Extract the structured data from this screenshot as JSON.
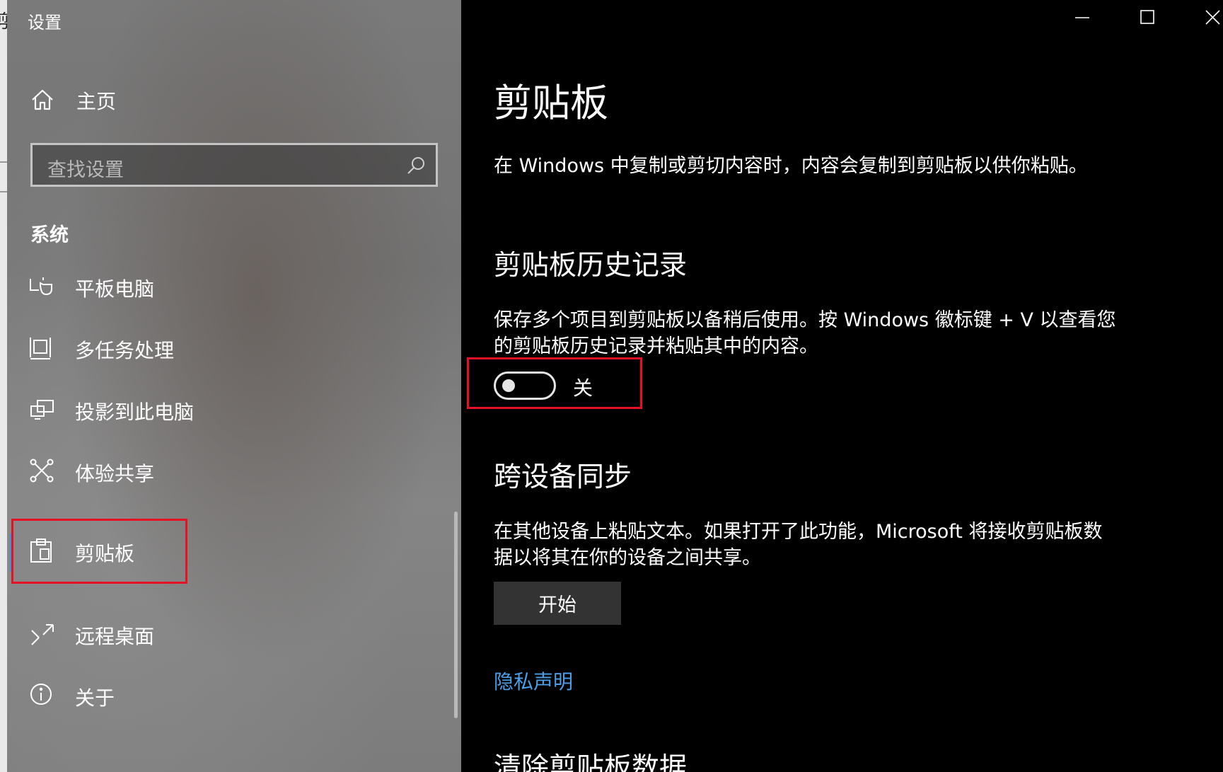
{
  "window": {
    "app_title": "设置",
    "controls": {
      "minimize_icon": "minimize-icon",
      "maximize_icon": "maximize-icon",
      "close_icon": "close-icon"
    }
  },
  "peek": {
    "char": "剪"
  },
  "sidebar": {
    "home": {
      "label": "主页",
      "icon": "home-icon"
    },
    "search": {
      "placeholder": "查找设置",
      "icon": "search-icon"
    },
    "section_label": "系统",
    "items": [
      {
        "label": "平板电脑",
        "icon": "tablet-icon",
        "selected": false
      },
      {
        "label": "多任务处理",
        "icon": "multitasking-icon",
        "selected": false
      },
      {
        "label": "投影到此电脑",
        "icon": "projecting-icon",
        "selected": false
      },
      {
        "label": "体验共享",
        "icon": "shared-experiences-icon",
        "selected": false
      },
      {
        "label": "剪贴板",
        "icon": "clipboard-icon",
        "selected": true
      },
      {
        "label": "远程桌面",
        "icon": "remote-desktop-icon",
        "selected": false
      },
      {
        "label": "关于",
        "icon": "info-icon",
        "selected": false
      }
    ]
  },
  "content": {
    "title": "剪贴板",
    "intro": "在 Windows 中复制或剪切内容时，内容会复制到剪贴板以供你粘贴。",
    "history": {
      "heading": "剪贴板历史记录",
      "description": "保存多个项目到剪贴板以备稍后使用。按 Windows 徽标键 + V 以查看您的剪贴板历史记录并粘贴其中的内容。",
      "toggle_state": "关",
      "toggle_on": false
    },
    "sync": {
      "heading": "跨设备同步",
      "description": "在其他设备上粘贴文本。如果打开了此功能，Microsoft 将接收剪贴板数据以将其在你的设备之间共享。",
      "button_label": "开始"
    },
    "privacy_link": "隐私声明",
    "clear": {
      "heading": "清除剪贴板数据"
    }
  },
  "colors": {
    "accent": "#3a8ee6",
    "highlight_border": "#e81123",
    "link": "#4a9fe8",
    "content_bg": "#000000",
    "button_bg": "#333333"
  }
}
